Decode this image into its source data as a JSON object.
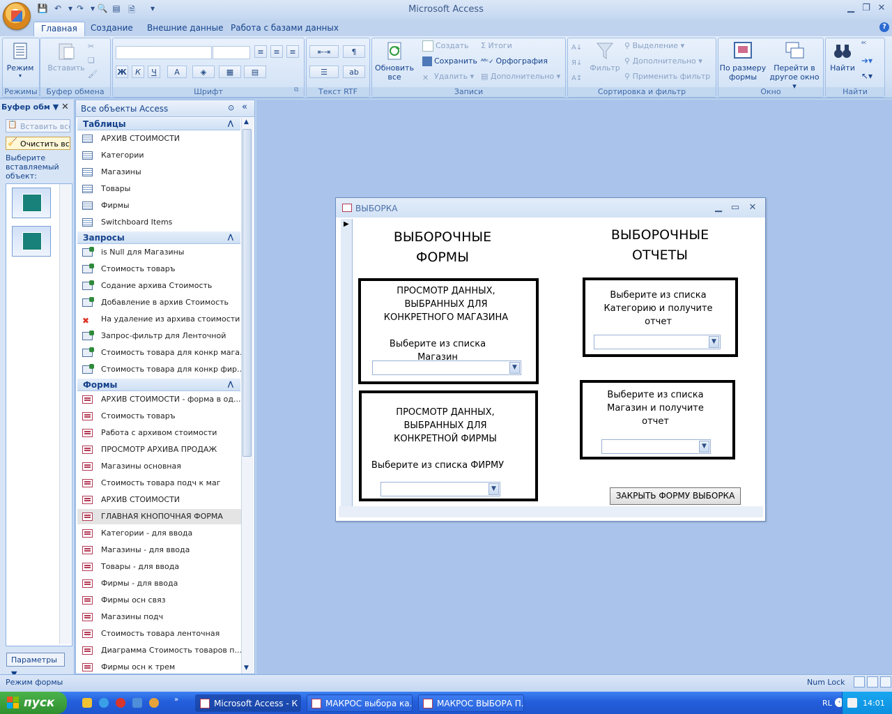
{
  "window": {
    "title": "Microsoft Access"
  },
  "ribbon_tabs": [
    "Главная",
    "Создание",
    "Внешние данные",
    "Работа с базами данных"
  ],
  "ribbon": {
    "modes": {
      "button": "Режим",
      "group": "Режимы"
    },
    "clipboard": {
      "paste": "Вставить",
      "group": "Буфер обмена"
    },
    "font": {
      "group": "Шрифт",
      "bold": "Ж",
      "italic": "К",
      "underline": "Ч",
      "color": "A"
    },
    "rtf": {
      "group": "Текст RTF"
    },
    "records": {
      "refresh_line1": "Обновить",
      "refresh_line2": "все",
      "create": "Создать",
      "save": "Сохранить",
      "delete": "Удалить",
      "totals": "Итоги",
      "spelling": "Орфография",
      "more": "Дополнительно",
      "group": "Записи"
    },
    "sort": {
      "filter": "Фильтр",
      "selection": "Выделение",
      "advanced": "Дополнительно",
      "apply_filter": "Применить фильтр",
      "group": "Сортировка и фильтр"
    },
    "window": {
      "fit_line1": "По размеру",
      "fit_line2": "формы",
      "switch_line1": "Перейти в",
      "switch_line2": "другое окно",
      "group": "Окно"
    },
    "find": {
      "button": "Найти",
      "group": "Найти"
    }
  },
  "clipboard_pane": {
    "title": "Буфер обм",
    "paste_all": "Вставить все",
    "clear_all": "Очистить все",
    "hint": "Выберите вставляемый объект:",
    "options": "Параметры"
  },
  "nav": {
    "title": "Все объекты Access",
    "sections": [
      {
        "name": "Таблицы",
        "items": [
          {
            "label": "АРХИВ СТОИМОСТИ",
            "icon": "table"
          },
          {
            "label": "Категории",
            "icon": "table"
          },
          {
            "label": "Магазины",
            "icon": "table"
          },
          {
            "label": "Товары",
            "icon": "table"
          },
          {
            "label": "Фирмы",
            "icon": "table"
          },
          {
            "label": "Switchboard Items",
            "icon": "table"
          }
        ]
      },
      {
        "name": "Запросы",
        "items": [
          {
            "label": "is Null для Магазины",
            "icon": "query"
          },
          {
            "label": "Стоимость товаръ",
            "icon": "query"
          },
          {
            "label": "Содание архива Стоимость",
            "icon": "query"
          },
          {
            "label": "Добавление в архив Стоимость",
            "icon": "query"
          },
          {
            "label": "На удаление из архива стоимости",
            "icon": "del"
          },
          {
            "label": "Запрос-фильтр для Ленточной",
            "icon": "query"
          },
          {
            "label": "Стоимость товара для конкр мага...",
            "icon": "query"
          },
          {
            "label": "Стоимость товара для конкр фир...",
            "icon": "query"
          }
        ]
      },
      {
        "name": "Формы",
        "items": [
          {
            "label": "АРХИВ СТОИМОСТИ - форма в од...",
            "icon": "form"
          },
          {
            "label": "Стоимость товаръ",
            "icon": "form"
          },
          {
            "label": "Работа с архивом стоимости",
            "icon": "form"
          },
          {
            "label": "ПРОСМОТР АРХИВА ПРОДАЖ",
            "icon": "form"
          },
          {
            "label": "Магазины основная",
            "icon": "form"
          },
          {
            "label": "Стоимость товара подч к маг",
            "icon": "form"
          },
          {
            "label": "АРХИВ СТОИМОСТИ",
            "icon": "form"
          },
          {
            "label": "ГЛАВНАЯ КНОПОЧНАЯ ФОРМА",
            "icon": "form"
          },
          {
            "label": "Категории - для ввода",
            "icon": "form"
          },
          {
            "label": "Магазины - для ввода",
            "icon": "form"
          },
          {
            "label": "Товары - для ввода",
            "icon": "form"
          },
          {
            "label": "Фирмы - для ввода",
            "icon": "form"
          },
          {
            "label": "Фирмы осн связ",
            "icon": "form"
          },
          {
            "label": "Магазины подч",
            "icon": "form"
          },
          {
            "label": "Стоимость товара ленточная",
            "icon": "form"
          },
          {
            "label": "Диаграмма Стоимость товаров п...",
            "icon": "form"
          },
          {
            "label": "Фирмы осн к трем",
            "icon": "form"
          }
        ]
      }
    ]
  },
  "form": {
    "title": "ВЫБОРКА",
    "left_heading_1": "ВЫБОРОЧНЫЕ",
    "left_heading_2": "ФОРМЫ",
    "right_heading_1": "ВЫБОРОЧНЫЕ",
    "right_heading_2": "ОТЧЕТЫ",
    "box1": {
      "l1": "ПРОСМОТР ДАННЫХ,",
      "l2": "ВЫБРАННЫХ ДЛЯ",
      "l3": "КОНКРЕТНОГО МАГАЗИНА",
      "prompt": "Выберите из списка Магазин"
    },
    "box2": {
      "l1": "ПРОСМОТР ДАННЫХ,",
      "l2": "ВЫБРАННЫХ ДЛЯ",
      "l3": "КОНКРЕТНОЙ ФИРМЫ",
      "prompt": "Выберите из списка ФИРМУ"
    },
    "box3": {
      "l1": "Выберите из списка",
      "l2": "Категорию и получите",
      "l3": "отчет"
    },
    "box4": {
      "l1": "Выберите из списка",
      "l2": "Магазин и получите",
      "l3": "отчет"
    },
    "close_button": "ЗАКРЫТЬ ФОРМУ ВЫБОРКА"
  },
  "status": {
    "mode": "Режим формы",
    "numlock": "Num Lock"
  },
  "taskbar": {
    "start": "пуск",
    "buttons": [
      "Microsoft Access - К ...",
      "МАКРОС выбора ка...",
      "МАКРОС ВЫБОРА П..."
    ],
    "lang": "RL",
    "clock": "14:01"
  }
}
